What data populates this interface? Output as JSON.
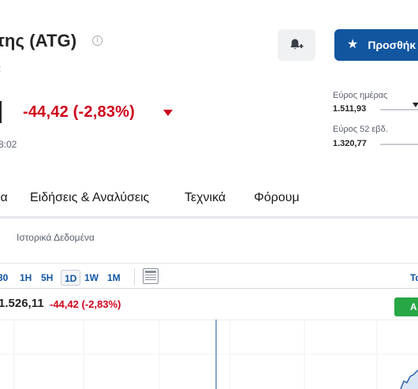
{
  "header": {
    "title": "της (ATG)",
    "subtitle_fragment": ":",
    "add_button_label": "Προσθήκ"
  },
  "quote": {
    "change": "-44,42 (-2,83%)",
    "time": "8:02"
  },
  "ranges": {
    "day_label": "Εύρος ημέρας",
    "day_low": "1.511,93",
    "week52_label": "Εύρος 52 εβδ.",
    "week52_low": "1.320,77"
  },
  "tabs": [
    "ια",
    "Ειδήσεις & Αναλύσεις",
    "Τεχνικά",
    "Φόρουμ"
  ],
  "subtabs": {
    "historical": "Ιστορικά Δεδομένα"
  },
  "intervals": [
    "30",
    "1H",
    "5H",
    "1D",
    "1W",
    "1M"
  ],
  "active_interval": "1D",
  "toolbar": {
    "right_label": "Τα"
  },
  "chart_header": {
    "price": "1.526,11",
    "change": "-44,42",
    "change_pct": "(-2,83%)",
    "badge": "A"
  },
  "colors": {
    "accent": "#1256a0",
    "negative": "#d0021b",
    "positive": "#28a745",
    "line": "#2a5fb0"
  },
  "icons": {
    "info": "info-icon",
    "bell": "bell-plus-icon",
    "star": "star-icon",
    "caret": "caret-down-icon",
    "layout": "layout-icon"
  }
}
